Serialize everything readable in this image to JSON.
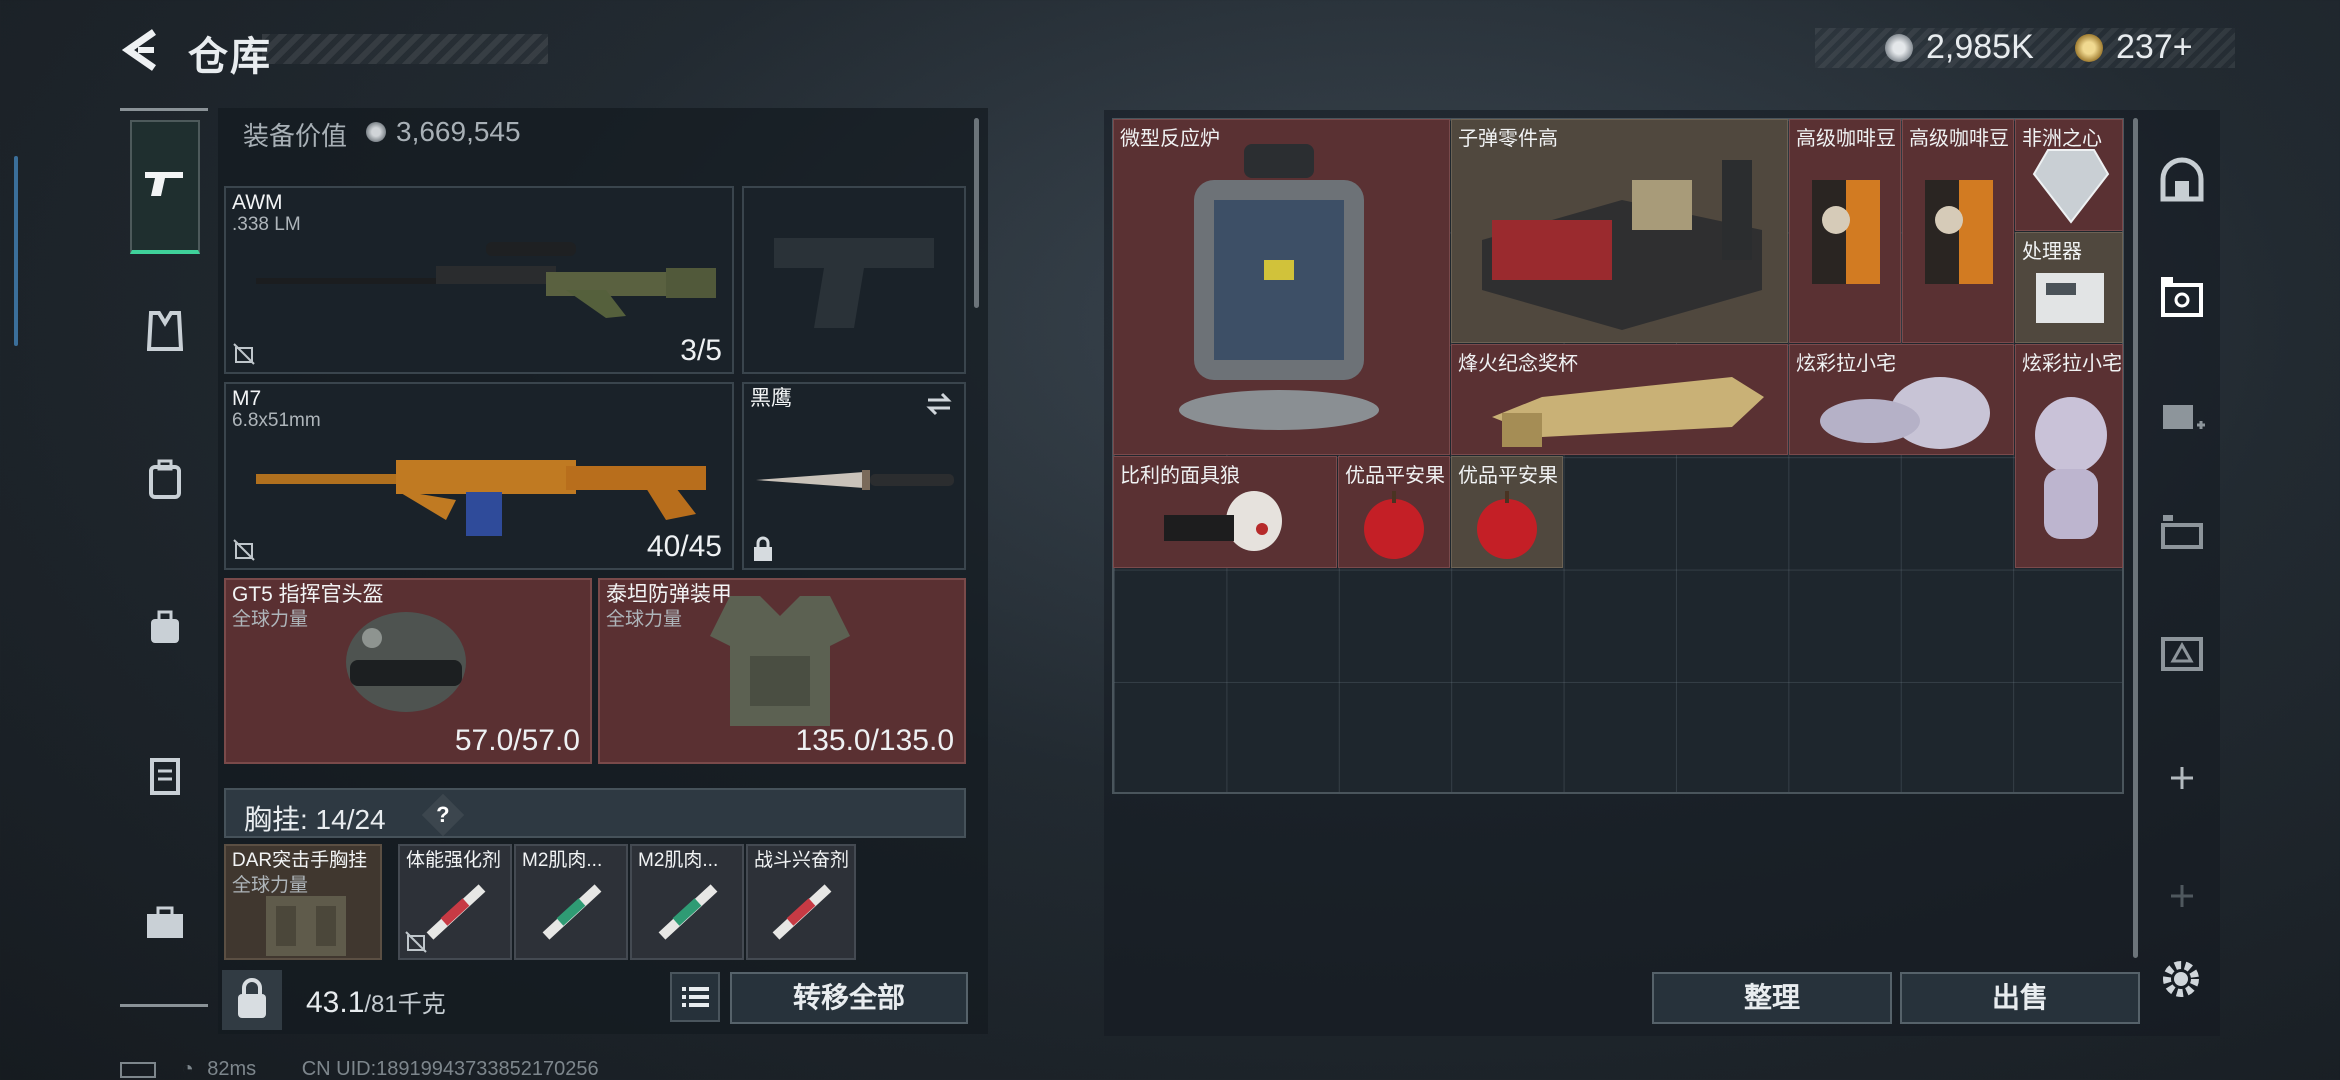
{
  "header": {
    "title": "仓库",
    "currency1": "2,985K",
    "currency2": "237+"
  },
  "equip_value": {
    "label": "装备价值",
    "value": "3,669,545"
  },
  "weapons": [
    {
      "name": "AWM",
      "ammo_type": ".338 LM",
      "count": "3/5"
    },
    {
      "name": "M7",
      "ammo_type": "6.8x51mm",
      "count": "40/45"
    }
  ],
  "melee": {
    "name": "黑鹰"
  },
  "helmet": {
    "name": "GT5 指挥官头盔",
    "sub": "全球力量",
    "durability": "57.0/57.0"
  },
  "armor": {
    "name": "泰坦防弹装甲",
    "sub": "全球力量",
    "durability": "135.0/135.0"
  },
  "chest_rig": {
    "label": "胸挂: 14/24",
    "help": "?",
    "rig_name": "DAR突击手胸挂",
    "rig_sub": "全球力量",
    "items": [
      "体能强化剂",
      "M2肌肉...",
      "M2肌肉...",
      "战斗兴奋剂"
    ]
  },
  "footer_left": {
    "weight": "43.1",
    "weight_max": "/81千克",
    "transfer_all": "转移全部"
  },
  "stash_items": [
    {
      "label": "微型反应炉"
    },
    {
      "label": "子弹零件高"
    },
    {
      "label": "高级咖啡豆"
    },
    {
      "label": "高级咖啡豆"
    },
    {
      "label": "非洲之心"
    },
    {
      "label": "处理器"
    },
    {
      "label": "烽火纪念奖杯"
    },
    {
      "label": "炫彩拉小宅"
    },
    {
      "label": "炫彩拉小宅"
    },
    {
      "label": "比利的面具狼"
    },
    {
      "label": "优品平安果"
    },
    {
      "label": "优品平安果"
    }
  ],
  "footer_right": {
    "sort": "整理",
    "sell": "出售"
  },
  "status": {
    "ping": "82ms",
    "uid": "CN UID:18919943733852170256"
  }
}
